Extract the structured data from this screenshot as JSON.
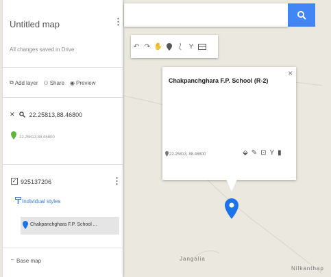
{
  "panel": {
    "map_title": "Untitled map",
    "save_status": "All changes saved in Drive",
    "add_layer_label": "Add layer",
    "share_label": "Share",
    "preview_label": "Preview",
    "search_query": "22.25813,88.46800",
    "search_result_coords": "22.25813,88.46800",
    "layer_name": "925137206",
    "individual_styles_label": "Individual styles",
    "place_item_label": "Chakpanchghara F.P. School ...",
    "basemap_label": "Base map"
  },
  "popup": {
    "place_title": "Chakpanchghara F.P. School (R-2)",
    "coordinates": "22.25813, 88.46800"
  },
  "map_labels": {
    "jangalia": "Jangalia",
    "nilkantha": "Nilkanthap"
  },
  "colors": {
    "accent_blue": "#4285f4",
    "pin_blue": "#1a73e8",
    "link_blue": "#3b7bd6",
    "search_pin_green": "#62b33d"
  },
  "icons": {
    "search_button": "search-icon",
    "pin": "map-pin-icon"
  }
}
